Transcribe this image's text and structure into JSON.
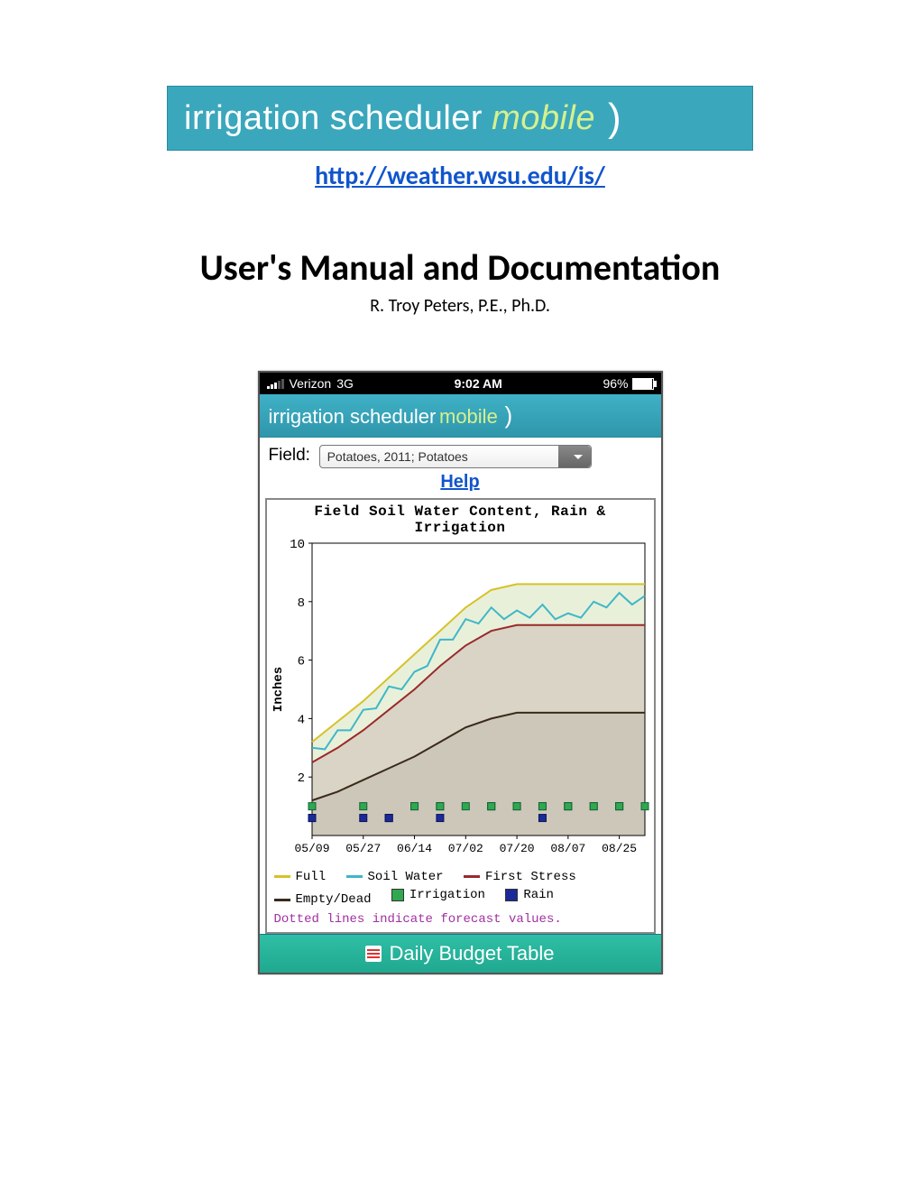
{
  "banner": {
    "text_main": "irrigation scheduler",
    "text_sub": "mobile"
  },
  "link": {
    "url_text": "http://weather.wsu.edu/is/"
  },
  "headline": "User's Manual and Documentation",
  "author": "R. Troy Peters, P.E., Ph.D.",
  "phone": {
    "status": {
      "carrier": "Verizon",
      "network": "3G",
      "time": "9:02 AM",
      "battery_pct": "96%"
    },
    "appbar": {
      "text_main": "irrigation scheduler",
      "text_sub": "mobile"
    },
    "field_row": {
      "label": "Field:",
      "selected": "Potatoes, 2011; Potatoes"
    },
    "help_label": "Help",
    "chart": {
      "title": "Field Soil Water Content, Rain & Irrigation",
      "ylabel": "Inches",
      "forecast_note": "Dotted lines indicate forecast values."
    },
    "legend": {
      "full": "Full",
      "soil_water": "Soil Water",
      "first_stress": "First Stress",
      "empty_dead": "Empty/Dead",
      "irrigation": "Irrigation",
      "rain": "Rain"
    },
    "footer_button": "Daily Budget Table"
  },
  "chart_data": {
    "type": "line",
    "xlabel": "",
    "ylabel": "Inches",
    "ylim": [
      0,
      10
    ],
    "x_ticks": [
      "05/09",
      "05/27",
      "06/14",
      "07/02",
      "07/20",
      "08/07",
      "08/25"
    ],
    "y_ticks": [
      2,
      4,
      6,
      8,
      10
    ],
    "categories": [
      "05/09",
      "05/18",
      "05/27",
      "06/05",
      "06/14",
      "06/23",
      "07/02",
      "07/11",
      "07/20",
      "07/29",
      "08/07",
      "08/16",
      "08/25",
      "09/03"
    ],
    "series": [
      {
        "name": "Full",
        "color": "#d6c22a",
        "values": [
          3.2,
          3.9,
          4.6,
          5.4,
          6.2,
          7.0,
          7.8,
          8.4,
          8.6,
          8.6,
          8.6,
          8.6,
          8.6,
          8.6
        ]
      },
      {
        "name": "Soil Water",
        "color": "#3fb7c7",
        "values": [
          3.0,
          3.6,
          4.3,
          5.1,
          5.6,
          6.7,
          7.4,
          7.8,
          7.7,
          7.9,
          7.6,
          8.0,
          8.3,
          8.2
        ]
      },
      {
        "name": "First Stress",
        "color": "#9a2a2a",
        "values": [
          2.5,
          3.0,
          3.6,
          4.3,
          5.0,
          5.8,
          6.5,
          7.0,
          7.2,
          7.2,
          7.2,
          7.2,
          7.2,
          7.2
        ]
      },
      {
        "name": "Empty/Dead",
        "color": "#3a2a1a",
        "values": [
          1.2,
          1.5,
          1.9,
          2.3,
          2.7,
          3.2,
          3.7,
          4.0,
          4.2,
          4.2,
          4.2,
          4.2,
          4.2,
          4.2
        ]
      }
    ],
    "irrigation_events": {
      "name": "Irrigation",
      "color": "#2fa84f",
      "x": [
        "05/12",
        "05/27",
        "06/14",
        "06/17",
        "06/20",
        "06/26",
        "06/29",
        "07/02",
        "07/08",
        "07/11",
        "07/14",
        "07/17",
        "07/23",
        "07/26",
        "07/29",
        "08/01",
        "08/04",
        "08/07",
        "08/13",
        "08/16",
        "08/22",
        "08/25",
        "08/31",
        "09/03"
      ],
      "y": 1.0
    },
    "rain_events": {
      "name": "Rain",
      "color": "#1a2a99",
      "x": [
        "05/09",
        "05/12",
        "05/30",
        "06/02",
        "06/05",
        "06/08",
        "06/20",
        "07/26"
      ],
      "y": 0.6
    },
    "title": "Field Soil Water Content, Rain & Irrigation"
  }
}
